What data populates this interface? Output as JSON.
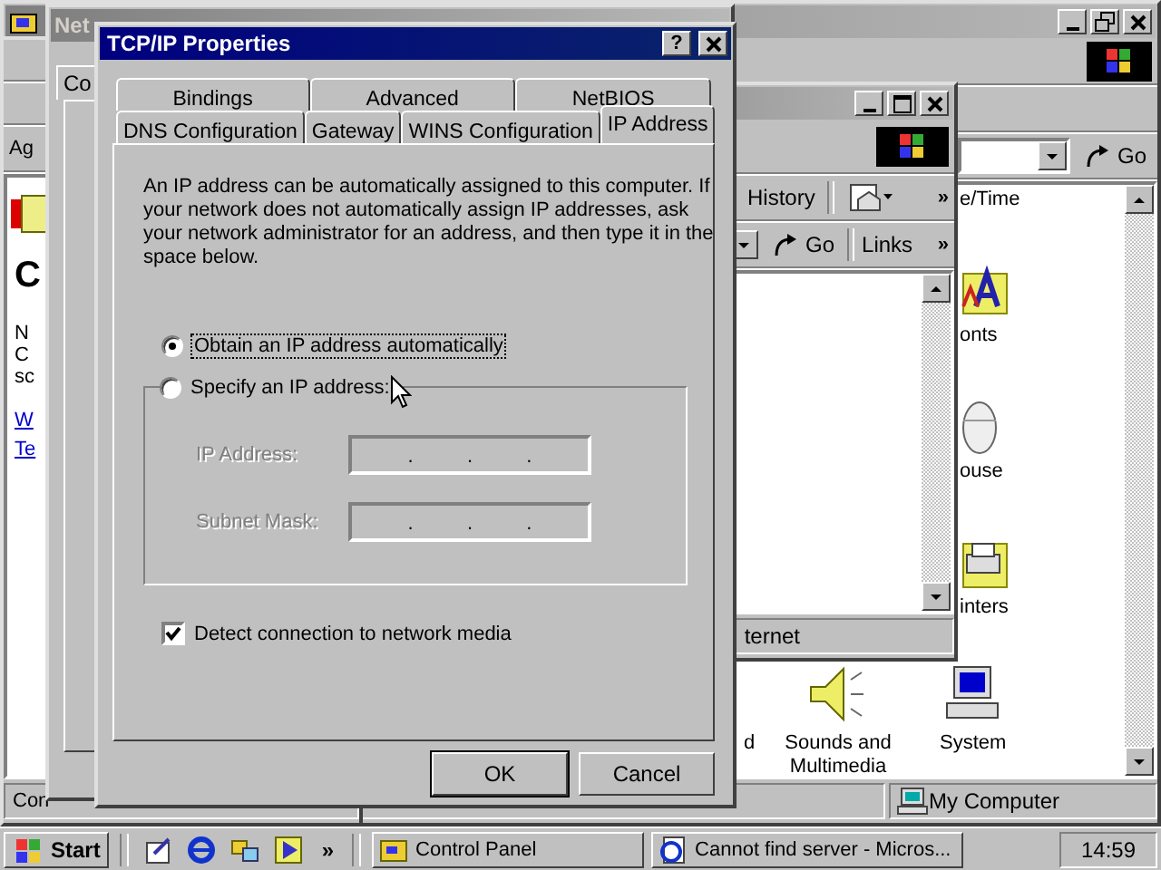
{
  "control_panel_window": {
    "go_button": "Go",
    "items": [
      {
        "label": "e/Time",
        "kind": "text"
      },
      {
        "label": "onts",
        "kind": "fonts"
      },
      {
        "label": "ouse",
        "kind": "mouse"
      },
      {
        "label": "inters",
        "kind": "printers"
      },
      {
        "label": "d",
        "kind": "text"
      },
      {
        "label": "Sounds and Multimedia",
        "kind": "sounds"
      },
      {
        "label": "System",
        "kind": "system"
      }
    ],
    "status_bar": {
      "location": "My Computer"
    }
  },
  "browser_window": {
    "address_label": "Ag",
    "heading": "C",
    "text_lines": [
      "N",
      "C",
      "sc"
    ],
    "links": [
      "W",
      "Te"
    ],
    "status_bar": "Con"
  },
  "ie_window": {
    "history_button": "History",
    "more_buttons": [
      "»",
      "»"
    ],
    "go_button": "Go",
    "links_label": "Links",
    "status_bar": "ternet"
  },
  "network_window": {
    "title": "Net",
    "tab": "Co"
  },
  "dialog": {
    "title": "TCP/IP Properties",
    "help_button": "?",
    "tab_rows": [
      [
        {
          "label": "Bindings",
          "selected": false
        },
        {
          "label": "Advanced",
          "selected": false
        },
        {
          "label": "NetBIOS",
          "selected": false
        }
      ],
      [
        {
          "label": "DNS Configuration",
          "selected": false
        },
        {
          "label": "Gateway",
          "selected": false
        },
        {
          "label": "WINS Configuration",
          "selected": false
        },
        {
          "label": "IP Address",
          "selected": true
        }
      ]
    ],
    "intro": "An IP address can be automatically assigned to this computer. If your network does not automatically assign IP addresses, ask your network administrator for an address, and then type it in the space below.",
    "options": [
      {
        "label": "Obtain an IP address automatically",
        "selected": true
      },
      {
        "label": "Specify an IP address:",
        "selected": false
      }
    ],
    "fields": [
      {
        "label": "IP Address:",
        "disabled": true,
        "separators": [
          ".",
          ".",
          "."
        ]
      },
      {
        "label": "Subnet Mask:",
        "disabled": true,
        "separators": [
          ".",
          ".",
          "."
        ]
      }
    ],
    "detect_checkbox": {
      "label": "Detect connection to network media",
      "checked": true
    },
    "buttons": [
      "OK",
      "Cancel"
    ]
  },
  "taskbar": {
    "start_button": "Start",
    "quick_launch_more": "»",
    "tasks": [
      {
        "label": "Control Panel"
      },
      {
        "label": "Cannot find server - Micros..."
      }
    ],
    "clock": "14:59"
  }
}
